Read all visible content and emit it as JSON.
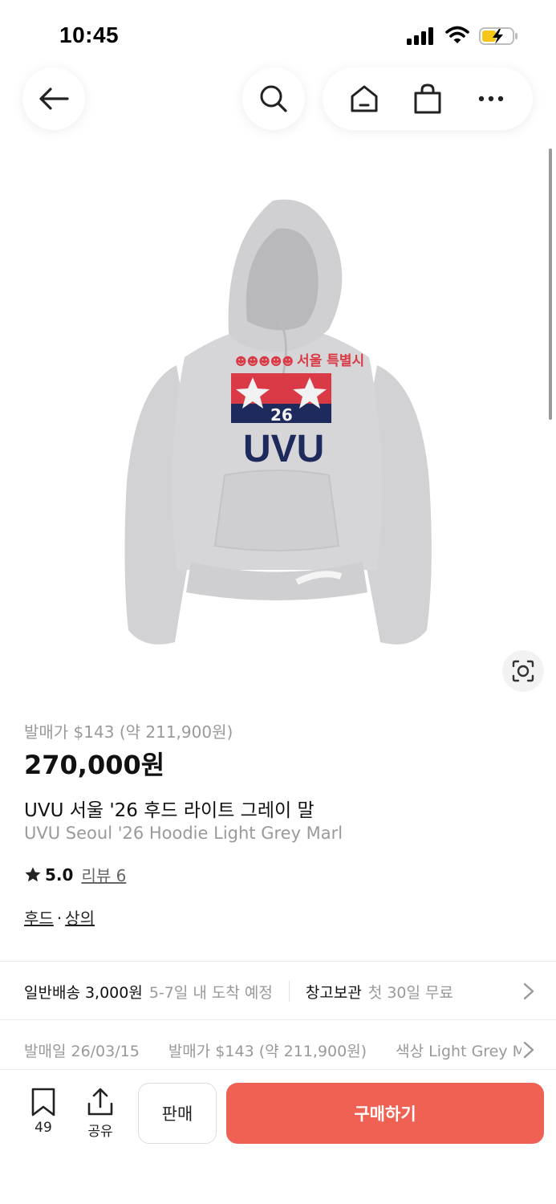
{
  "status_bar": {
    "time": "10:45",
    "icons": [
      "cellular-signal-icon",
      "wifi-icon",
      "battery-charging-icon"
    ]
  },
  "nav": {
    "icons": [
      "back-arrow-icon",
      "search-icon",
      "home-icon",
      "shopping-bag-icon",
      "more-icon"
    ]
  },
  "product": {
    "image_alt": "UVU Seoul '26 hoodie in light grey marl",
    "graphic_text": "UVU",
    "graphic_number": "26",
    "graphic_script": "서울 특별시",
    "release_price": "발매가 $143 (약 211,900원)",
    "price": "270,000원",
    "title_ko": "UVU 서울 '26 후드 라이트 그레이 말",
    "title_en": "UVU Seoul '26 Hoodie Light Grey Marl",
    "rating": "5.0",
    "review_label": "리뷰 6",
    "categories": [
      "후드",
      "상의"
    ],
    "category_separator": "·"
  },
  "shipping": {
    "method": "일반배송 3,000원",
    "eta": "5-7일 내 도착 예정",
    "storage": "창고보관",
    "storage_note": "첫 30일 무료"
  },
  "info": {
    "release_date": "발매일 26/03/15",
    "release_price": "발매가 $143 (약 211,900원)",
    "color": "색상 Light Grey Marl"
  },
  "bottom_bar": {
    "bookmark_count": "49",
    "share_label": "공유",
    "sell_label": "판매",
    "buy_label": "구매하기"
  },
  "colors": {
    "accent": "#ef6253",
    "muted_text": "#9a9a9a",
    "hoodie": "#d4d4d6",
    "graphic_red": "#d93a45",
    "graphic_navy": "#1f2a5c"
  }
}
